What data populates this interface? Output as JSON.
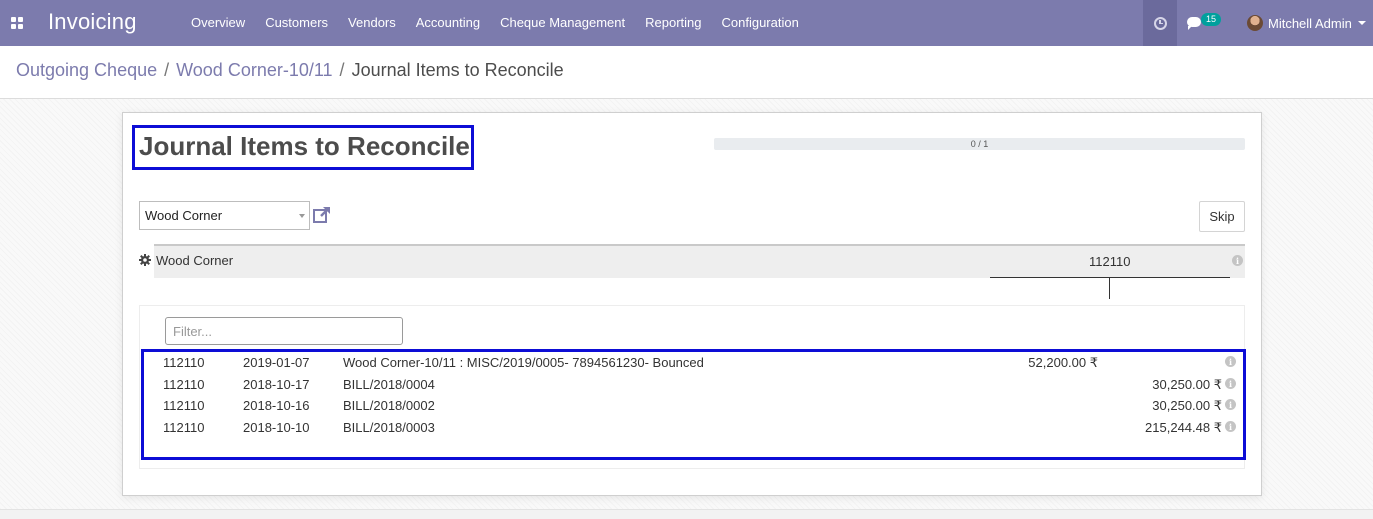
{
  "navbar": {
    "app_title": "Invoicing",
    "menu": [
      {
        "label": "Overview"
      },
      {
        "label": "Customers"
      },
      {
        "label": "Vendors"
      },
      {
        "label": "Accounting"
      },
      {
        "label": "Cheque Management"
      },
      {
        "label": "Reporting"
      },
      {
        "label": "Configuration"
      }
    ],
    "messages_count": "15",
    "user_name": "Mitchell Admin",
    "color": "#7c7bad"
  },
  "breadcrumb": [
    {
      "label": "Outgoing Cheque",
      "separator": "/"
    },
    {
      "label": "Wood Corner-10/11",
      "separator": "/"
    },
    {
      "label": "Journal Items to Reconcile"
    }
  ],
  "reconcile": {
    "title": "Journal Items to Reconcile",
    "progress": {
      "text": "0 / 1",
      "fraction": 0
    },
    "partner_select_value": "Wood Corner",
    "skip_label": "Skip",
    "partner_name": "Wood Corner",
    "account_code": "112110",
    "filter_placeholder": "Filter...",
    "lines": [
      {
        "account": "112110",
        "date": "2019-01-07",
        "label": "Wood Corner-10/11 : MISC/2019/0005- 7894561230- Bounced",
        "debit": "52,200.00 ₹",
        "credit": ""
      },
      {
        "account": "112110",
        "date": "2018-10-17",
        "label": "BILL/2018/0004",
        "debit": "",
        "credit": "30,250.00 ₹"
      },
      {
        "account": "112110",
        "date": "2018-10-16",
        "label": "BILL/2018/0002",
        "debit": "",
        "credit": "30,250.00 ₹"
      },
      {
        "account": "112110",
        "date": "2018-10-10",
        "label": "BILL/2018/0003",
        "debit": "",
        "credit": "215,244.48 ₹"
      }
    ]
  },
  "icons": {
    "apps": "apps-grid-icon",
    "activity": "clock-icon",
    "messages": "chat-icon",
    "external": "external-link-icon",
    "settings": "gear-icon",
    "info": "info-icon"
  },
  "colors": {
    "highlight_border": "#0d0dd6",
    "link": "#7c7bad"
  }
}
